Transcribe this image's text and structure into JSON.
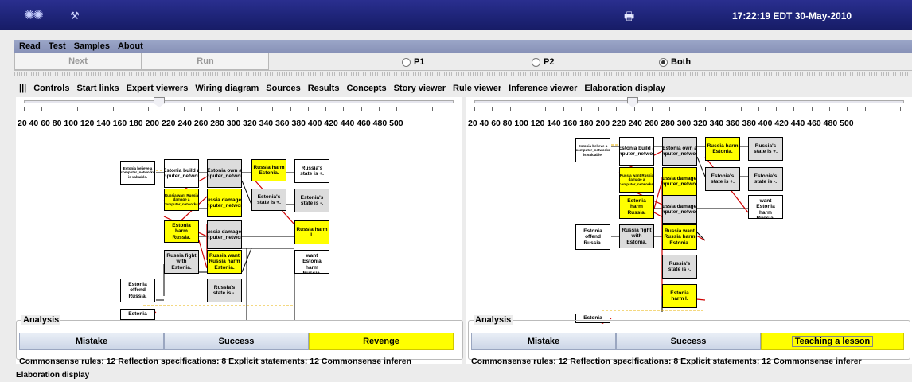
{
  "topbar": {
    "clock": "17:22:19 EDT 30-May-2010"
  },
  "menu": [
    "Read",
    "Test",
    "Samples",
    "About"
  ],
  "buttons": {
    "next": "Next",
    "run": "Run"
  },
  "radios": [
    {
      "label": "P1",
      "selected": false
    },
    {
      "label": "P2",
      "selected": false
    },
    {
      "label": "Both",
      "selected": true
    }
  ],
  "tabs": [
    "|||",
    "Controls",
    "Start links",
    "Expert viewers",
    "Wiring diagram",
    "Sources",
    "Results",
    "Concepts",
    "Story viewer",
    "Rule viewer",
    "Inference viewer",
    "Elaboration display"
  ],
  "scale": "20   40   60   80  100 120 140 160 180 200 220 240 260 280 300 320 340 360 380 400 420 440 460 480 500",
  "left": {
    "nodes": {
      "n1": "Estonia believe a computer_networks is valuable.",
      "n2": "Estonia build a computer_networks.",
      "n3": "Estonia own a computer_networks.",
      "n4": "Russia harm Estonia.",
      "n5": "Russia's state is +.",
      "n6": "Russia want Russia damage a computer_networks.",
      "n7": "Russia damage a computer_networks.",
      "n8": "Estonia's state is +.",
      "n9": "Estonia's state is -.",
      "n10": "Estonia harm Russia.",
      "n11": "Russia damage a computer_networks.",
      "n12": "Russia harm I.",
      "n13": "Russia fight with Estonia.",
      "n14": "Russia want Russia harm Estonia.",
      "n15": "Estonia want Estonia harm Russia.",
      "n16": "Estonia offend Russia.",
      "n17": "Russia's state is -.",
      "n18": "Estonia"
    },
    "analysis": "Analysis",
    "results": [
      "Mistake",
      "Success",
      "Revenge"
    ],
    "stats": "Commonsense rules: 12    Reflection specifications: 8    Explicit statements: 12    Commonsense inferen"
  },
  "right": {
    "nodes": {
      "n1": "Estonia believe a computer_networks is valuable.",
      "n2": "Estonia build a computer_networks.",
      "n3": "Estonia own a computer_networks.",
      "n4": "Russia harm Estonia.",
      "n5": "Russia's state is +.",
      "n6": "Russia want Russia damage a computer_networks.",
      "n7": "Russia damage a computer_networks.",
      "n8": "Estonia's state is +.",
      "n9": "Estonia's state is -.",
      "n10": "Estonia harm Russia.",
      "n11": "Russia damage a computer_networks.",
      "n12": "Estonia want Estonia harm Russia.",
      "n13": "Estonia offend Russia.",
      "n14": "Russia fight with Estonia.",
      "n15": "Russia want Russia harm Estonia.",
      "n16": "Russia's state is -.",
      "n17": "Estonia harm I.",
      "n18": "Estonia"
    },
    "analysis": "Analysis",
    "results": [
      "Mistake",
      "Success",
      "Teaching a lesson"
    ],
    "stats": "Commonsense rules: 12    Reflection specifications: 8    Explicit statements: 12    Commonsense inferer"
  },
  "footer": "Elaboration display"
}
